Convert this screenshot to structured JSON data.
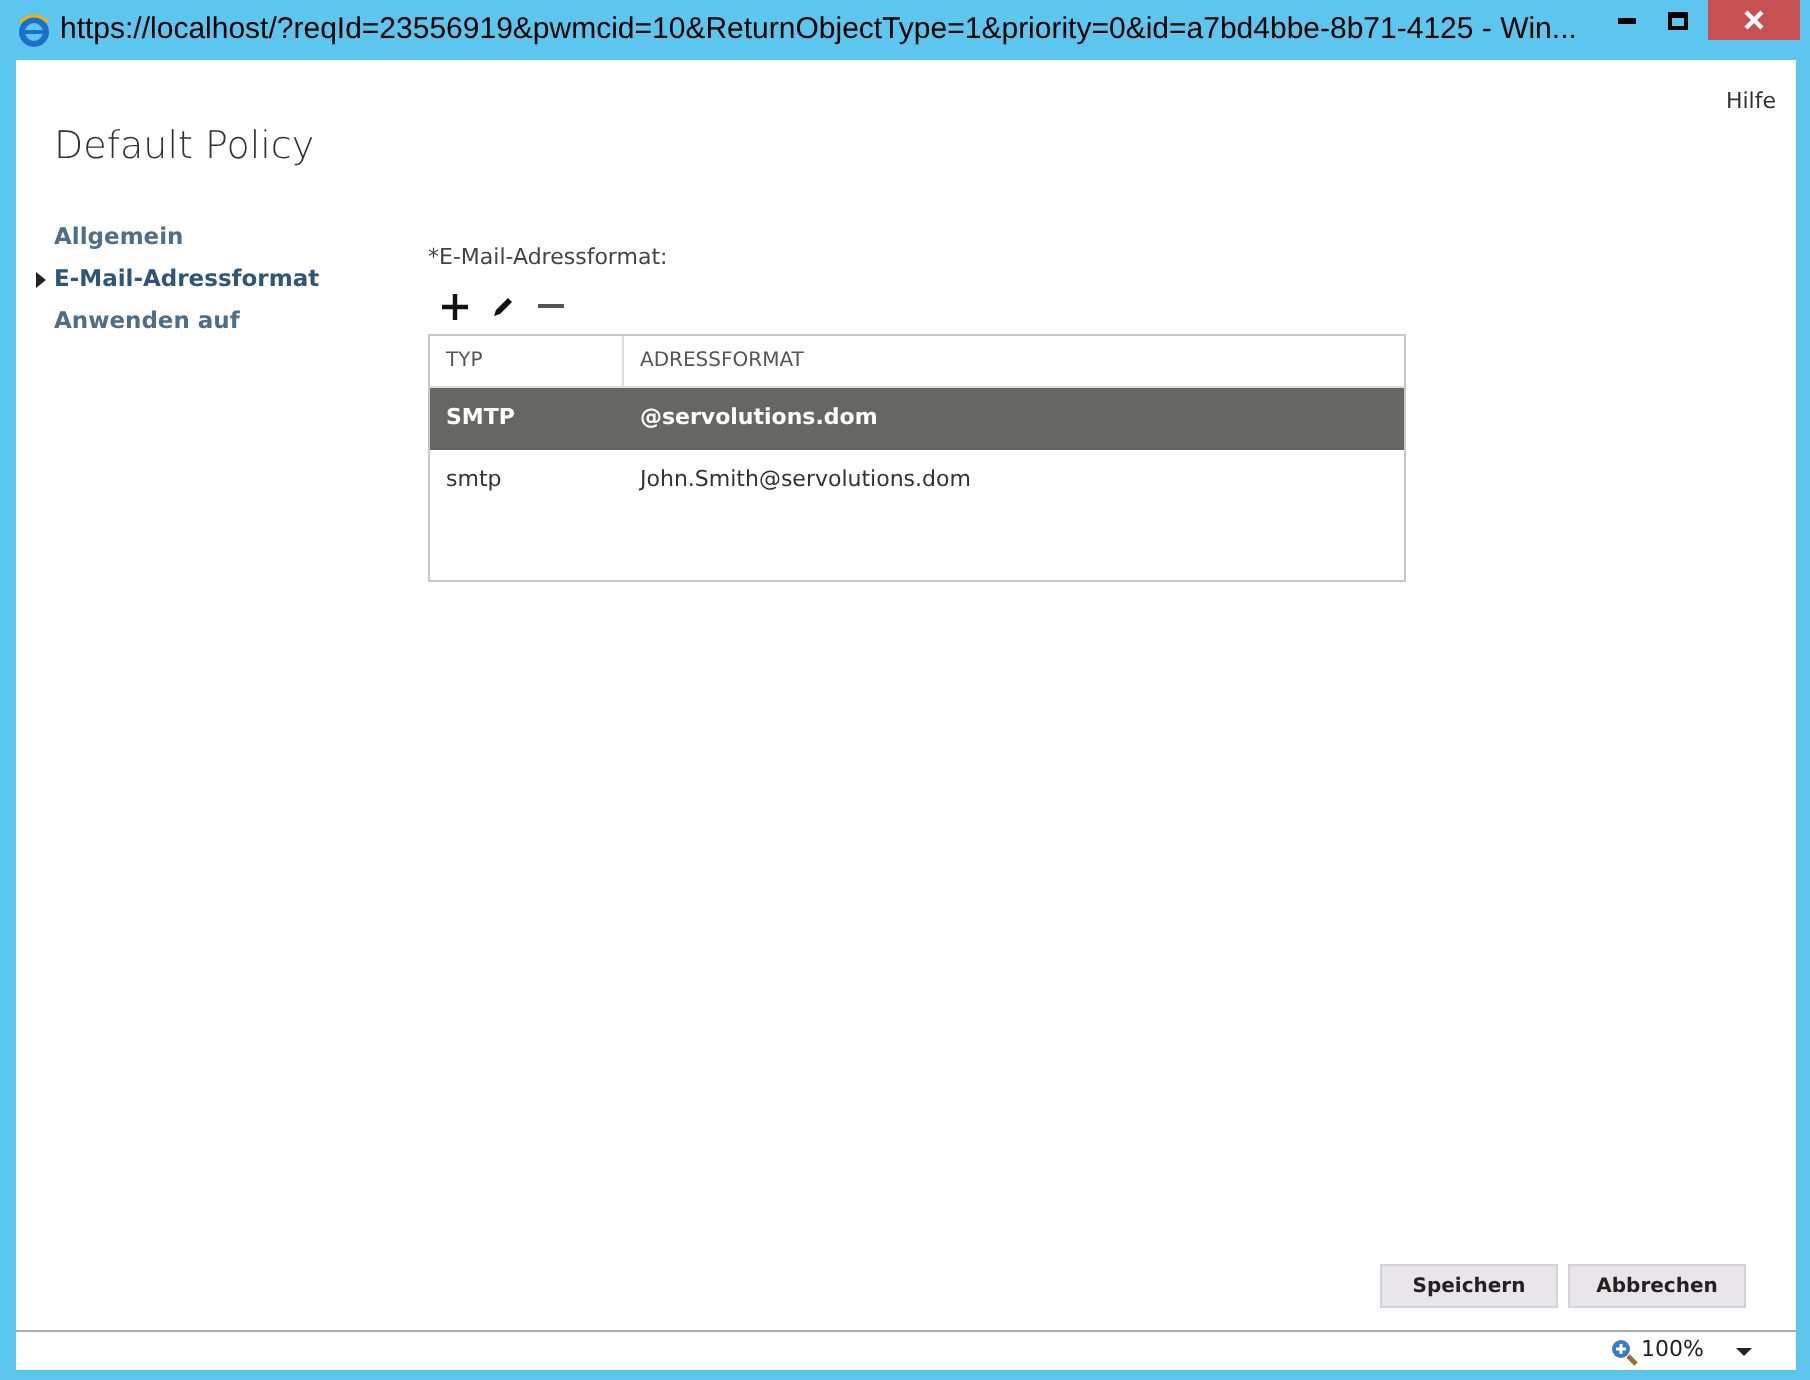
{
  "window": {
    "title": "https://localhost/?reqId=23556919&pwmcid=10&ReturnObjectType=1&priority=0&id=a7bd4bbe-8b71-4125 - Win..."
  },
  "help": "Hilfe",
  "heading": "Default Policy",
  "sidebar": {
    "items": [
      {
        "label": "Allgemein",
        "selected": false
      },
      {
        "label": "E-Mail-Adressformat",
        "selected": true
      },
      {
        "label": "Anwenden auf",
        "selected": false
      }
    ]
  },
  "field_label": "*E-Mail-Adressformat:",
  "table": {
    "columns": [
      "TYP",
      "ADRESSFORMAT"
    ],
    "rows": [
      {
        "cells": [
          "SMTP",
          "@servolutions.dom"
        ],
        "selected": true
      },
      {
        "cells": [
          "smtp",
          "John.Smith@servolutions.dom"
        ],
        "selected": false
      }
    ]
  },
  "buttons": [
    "Speichern",
    "Abbrechen"
  ],
  "status_bar": {
    "zoom": "100%"
  }
}
